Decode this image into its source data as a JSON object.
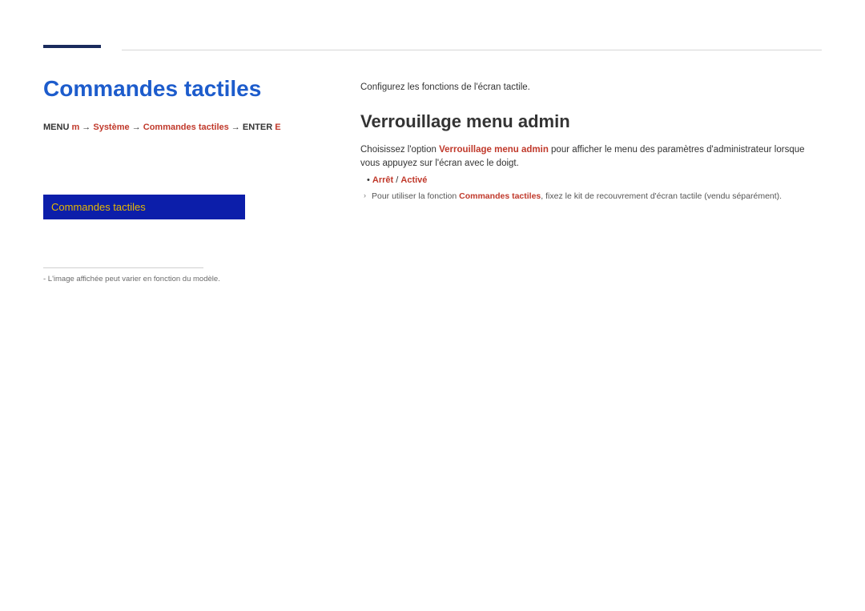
{
  "page": {
    "title": "Commandes tactiles"
  },
  "breadcrumb": {
    "prefix": "MENU",
    "b1": "m",
    "sep1": " → ",
    "b1b": "Système",
    "sep2": " → ",
    "b2": "Commandes tactiles",
    "sep3": " → ",
    "b3": "ENTER",
    "b3b": "E"
  },
  "screenshot": {
    "menu_item": "Commandes tactiles"
  },
  "footnote": {
    "text": "- L'image affichée peut varier en fonction du modèle."
  },
  "right": {
    "intro": "Configurez les fonctions de l'écran tactile.",
    "section_title": "Verrouillage menu admin",
    "body_a": "Choisissez l'option ",
    "body_accent": "Verrouillage menu admin",
    "body_b": " pour afficher le menu des paramètres d'administrateur lorsque vous appuyez sur l'écran avec le doigt.",
    "option_bullet": "•",
    "option_a": "Arrêt",
    "option_sep": " / ",
    "option_b": "Activé",
    "note_a": "Pour utiliser la fonction ",
    "note_accent": "Commandes tactiles",
    "note_b": ", fixez le kit de recouvrement d'écran tactile (vendu séparément)."
  }
}
